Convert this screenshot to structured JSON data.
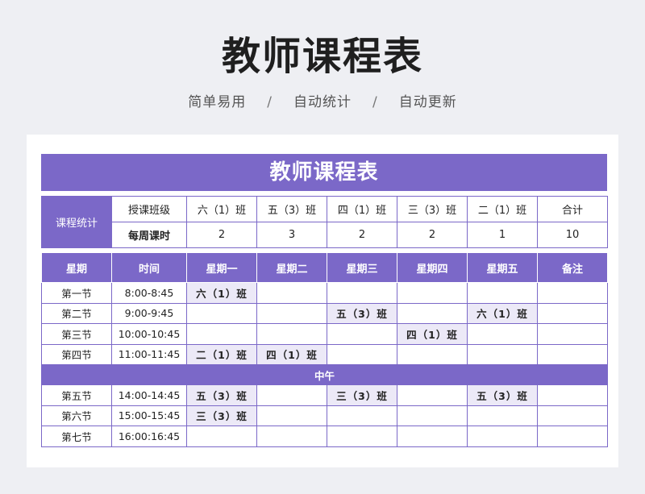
{
  "page": {
    "title": "教师课程表",
    "subtitle": [
      "简单易用",
      "自动统计",
      "自动更新"
    ],
    "separator": "/"
  },
  "sheet": {
    "banner": "教师课程表",
    "stats": {
      "label": "课程统计",
      "class_header": "授课班级",
      "count_header": "每周课时",
      "classes": [
        "六（1）班",
        "五（3）班",
        "四（1）班",
        "三（3）班",
        "二（1）班",
        "合计"
      ],
      "counts": [
        "2",
        "3",
        "2",
        "2",
        "1",
        "10"
      ]
    },
    "schedule": {
      "headers": [
        "星期",
        "时间",
        "星期一",
        "星期二",
        "星期三",
        "星期四",
        "星期五",
        "备注"
      ],
      "noon_label": "中午",
      "morning": [
        {
          "period": "第一节",
          "time": "8:00-8:45",
          "cells": [
            "六（1）班",
            "",
            "",
            "",
            "",
            ""
          ]
        },
        {
          "period": "第二节",
          "time": "9:00-9:45",
          "cells": [
            "",
            "",
            "五（3）班",
            "",
            "六（1）班",
            ""
          ]
        },
        {
          "period": "第三节",
          "time": "10:00-10:45",
          "cells": [
            "",
            "",
            "",
            "四（1）班",
            "",
            ""
          ]
        },
        {
          "period": "第四节",
          "time": "11:00-11:45",
          "cells": [
            "二（1）班",
            "四（1）班",
            "",
            "",
            "",
            ""
          ]
        }
      ],
      "afternoon": [
        {
          "period": "第五节",
          "time": "14:00-14:45",
          "cells": [
            "五（3）班",
            "",
            "三（3）班",
            "",
            "五（3）班",
            ""
          ]
        },
        {
          "period": "第六节",
          "time": "15:00-15:45",
          "cells": [
            "三（3）班",
            "",
            "",
            "",
            "",
            ""
          ]
        },
        {
          "period": "第七节",
          "time": "16:00:16:45",
          "cells": [
            "",
            "",
            "",
            "",
            "",
            ""
          ]
        }
      ]
    }
  },
  "colors": {
    "accent": "#7b68c8",
    "filled_cell": "#ece9f7",
    "background": "#eeeff3"
  }
}
